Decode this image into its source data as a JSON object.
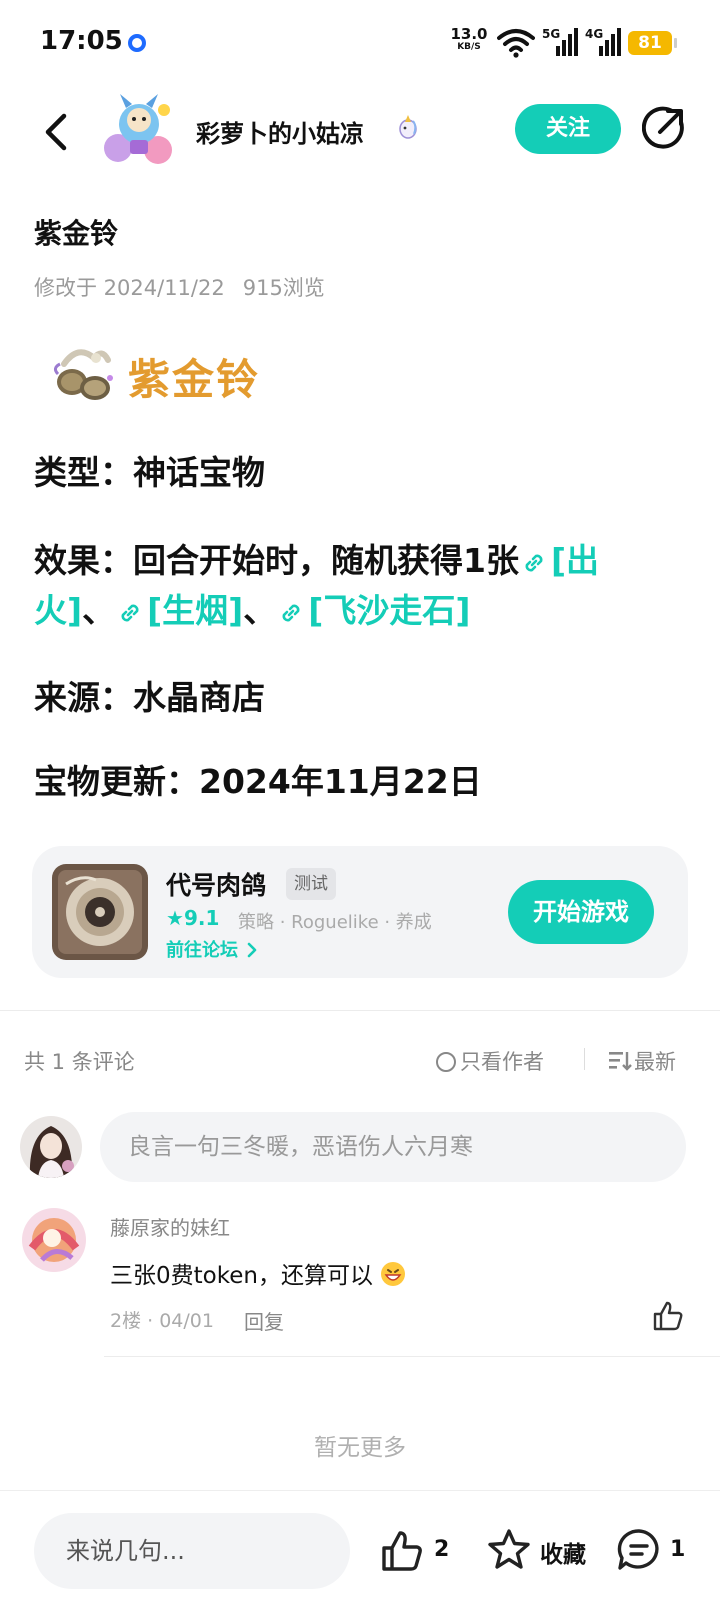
{
  "status": {
    "time": "17:05",
    "net_speed_value": "13.0",
    "net_speed_unit": "KB/S",
    "signal_1": "5G",
    "signal_2": "4G",
    "battery": "81"
  },
  "header": {
    "author_name": "彩萝卜的小姑凉",
    "follow_label": "关注",
    "icons": [
      "back-icon",
      "share-icon"
    ]
  },
  "post": {
    "title": "紫金铃",
    "modified": "修改于 2024/11/22",
    "views": "915浏览",
    "item_name": "紫金铃",
    "type_line": "类型：神话宝物",
    "effect_prefix": "效果：回合开始时，随机获得1张",
    "links": [
      "[出火]",
      "[生烟]",
      "[飞沙走石]"
    ],
    "sep": "、",
    "source_line": "来源：水晶商店",
    "update_line": "宝物更新：2024年11月22日"
  },
  "game_card": {
    "name": "代号肉鸽",
    "badge": "测试",
    "rating": "9.1",
    "tags": "策略 · Roguelike · 养成",
    "forum_link": "前往论坛",
    "play_label": "开始游戏"
  },
  "comments": {
    "count_label": "共 1 条评论",
    "author_only_label": "只看作者",
    "sort_label": "最新",
    "input_placeholder": "良言一句三冬暖，恶语伤人六月寒",
    "items": [
      {
        "name": "藤原家的妹红",
        "text": "三张0费token，还算可以",
        "meta": "2楼 · 04/01",
        "reply_label": "回复"
      }
    ],
    "no_more": "暂无更多"
  },
  "bottom_bar": {
    "input_placeholder": "来说几句...",
    "like_count": "2",
    "fav_label": "收藏",
    "comment_count": "1"
  },
  "colors": {
    "accent": "#14cdb7",
    "item_gold": "#e39b2f",
    "battery": "#f5b800"
  }
}
